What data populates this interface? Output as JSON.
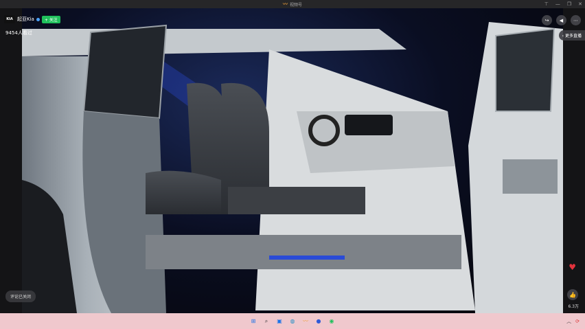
{
  "window": {
    "title": "视频号",
    "controls": [
      "pin",
      "minimize",
      "restore",
      "close"
    ]
  },
  "account": {
    "avatar_text": "KIA",
    "name": "起亚Kia",
    "follow_label": "+ 关注",
    "viewers": "9454人看过"
  },
  "top_actions": {
    "share_icon": "share-icon",
    "volume_icon": "volume-icon",
    "more_icon": "more-icon"
  },
  "more_live_label": "更多直播",
  "comments_status": "评论已关闭",
  "like": {
    "count": "6.3万"
  },
  "taskbar": {
    "apps": [
      "start-icon",
      "search-icon",
      "taskview-icon",
      "edge-icon",
      "wechat-channels-icon",
      "app-icon",
      "wechat-icon"
    ]
  },
  "colors": {
    "follow": "#20c05c",
    "heart": "#e2323c",
    "taskbar": "#f0c8cd"
  }
}
